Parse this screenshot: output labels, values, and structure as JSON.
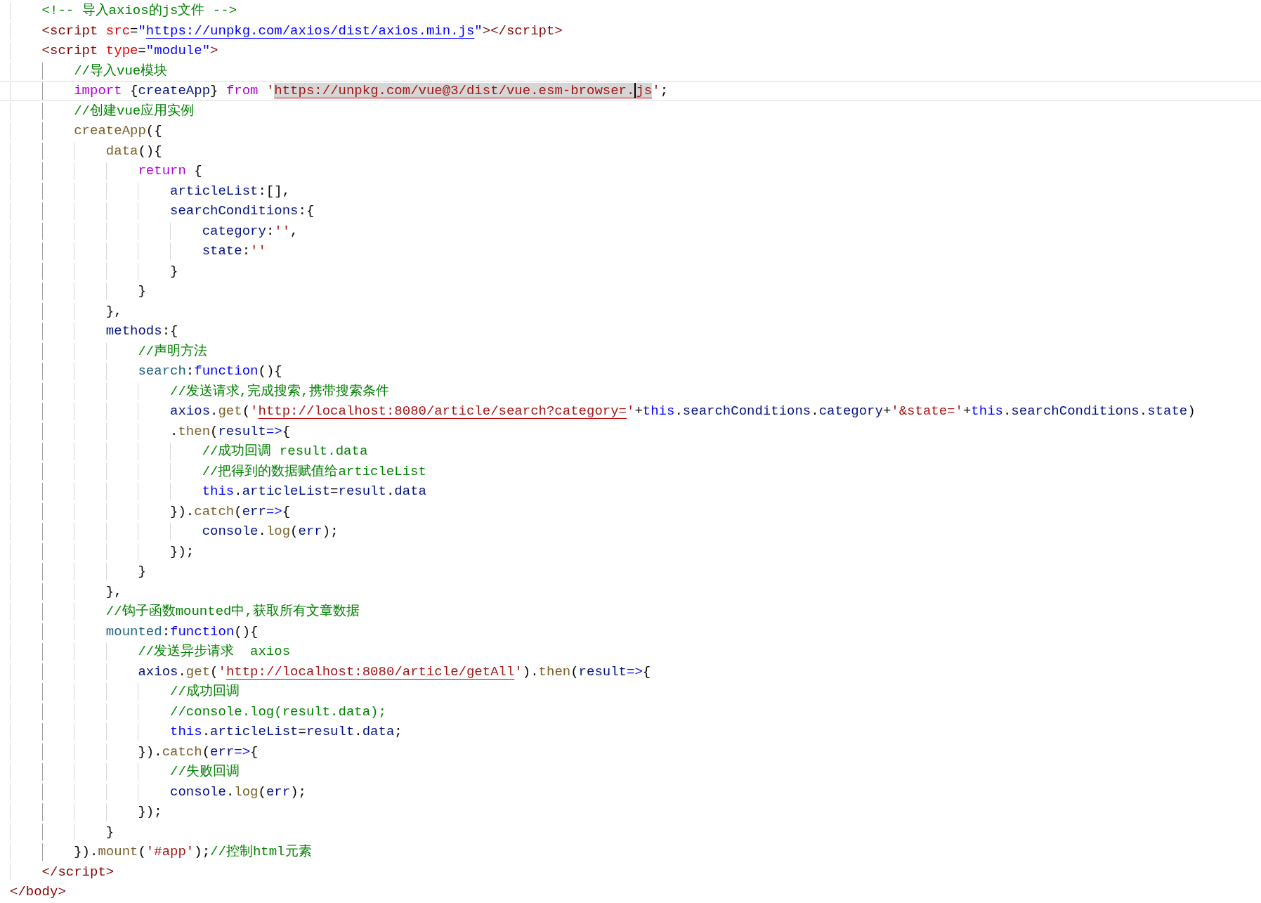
{
  "editor": {
    "lines": [
      {
        "selected": false,
        "tokens": [
          {
            "kind": "comment",
            "text": "    <!-- 导入axios的js文件 -->"
          }
        ]
      },
      {
        "selected": false,
        "tokens": [
          {
            "kind": "tag",
            "text": "    <script"
          },
          {
            "kind": "attr",
            "text": " src"
          },
          {
            "kind": "plain",
            "text": "="
          },
          {
            "kind": "attrval",
            "text": "\""
          },
          {
            "kind": "link",
            "text": "https://unpkg.com/axios/dist/axios.min.js"
          },
          {
            "kind": "attrval",
            "text": "\""
          },
          {
            "kind": "tag",
            "text": "></script>"
          }
        ]
      },
      {
        "selected": false,
        "tokens": [
          {
            "kind": "tag",
            "text": "    <script"
          },
          {
            "kind": "attr",
            "text": " type"
          },
          {
            "kind": "plain",
            "text": "="
          },
          {
            "kind": "attrval",
            "text": "\"module\""
          },
          {
            "kind": "tag",
            "text": ">"
          }
        ]
      },
      {
        "selected": false,
        "tokens": [
          {
            "kind": "comment",
            "text": "        //导入vue模块"
          }
        ]
      },
      {
        "selected": true,
        "tokens": [
          {
            "kind": "keyword",
            "text": "        import"
          },
          {
            "kind": "plain",
            "text": " {"
          },
          {
            "kind": "ident",
            "text": "createApp"
          },
          {
            "kind": "plain",
            "text": "} "
          },
          {
            "kind": "keyword",
            "text": "from"
          },
          {
            "kind": "string",
            "text": " '"
          },
          {
            "kind": "url-selection",
            "text": "https://unpkg.com/vue@3/dist/vue.esm-browser."
          },
          {
            "kind": "caret"
          },
          {
            "kind": "url-selection",
            "text": "js"
          },
          {
            "kind": "string",
            "text": "'"
          },
          {
            "kind": "plain",
            "text": ";"
          }
        ]
      },
      {
        "selected": false,
        "tokens": [
          {
            "kind": "comment",
            "text": "        //创建vue应用实例"
          }
        ]
      },
      {
        "selected": false,
        "tokens": [
          {
            "kind": "func",
            "text": "        createApp"
          },
          {
            "kind": "plain",
            "text": "({"
          }
        ]
      },
      {
        "selected": false,
        "tokens": [
          {
            "kind": "func",
            "text": "            data"
          },
          {
            "kind": "plain",
            "text": "(){"
          }
        ]
      },
      {
        "selected": false,
        "tokens": [
          {
            "kind": "keyword",
            "text": "                return"
          },
          {
            "kind": "plain",
            "text": " {"
          }
        ]
      },
      {
        "selected": false,
        "tokens": [
          {
            "kind": "ident",
            "text": "                    articleList"
          },
          {
            "kind": "plain",
            "text": ":[],"
          }
        ]
      },
      {
        "selected": false,
        "tokens": [
          {
            "kind": "ident",
            "text": "                    searchConditions"
          },
          {
            "kind": "plain",
            "text": ":{"
          }
        ]
      },
      {
        "selected": false,
        "tokens": [
          {
            "kind": "ident",
            "text": "                        category"
          },
          {
            "kind": "plain",
            "text": ":"
          },
          {
            "kind": "string",
            "text": "''"
          },
          {
            "kind": "plain",
            "text": ","
          }
        ]
      },
      {
        "selected": false,
        "tokens": [
          {
            "kind": "ident",
            "text": "                        state"
          },
          {
            "kind": "plain",
            "text": ":"
          },
          {
            "kind": "string",
            "text": "''"
          }
        ]
      },
      {
        "selected": false,
        "tokens": [
          {
            "kind": "plain",
            "text": "                    }"
          }
        ]
      },
      {
        "selected": false,
        "tokens": [
          {
            "kind": "plain",
            "text": "                }"
          }
        ]
      },
      {
        "selected": false,
        "tokens": [
          {
            "kind": "plain",
            "text": "            },"
          }
        ]
      },
      {
        "selected": false,
        "tokens": [
          {
            "kind": "ident",
            "text": "            methods"
          },
          {
            "kind": "plain",
            "text": ":{"
          }
        ]
      },
      {
        "selected": false,
        "tokens": [
          {
            "kind": "comment",
            "text": "                //声明方法"
          }
        ]
      },
      {
        "selected": false,
        "tokens": [
          {
            "kind": "property",
            "text": "                search"
          },
          {
            "kind": "plain",
            "text": ":"
          },
          {
            "kind": "storage",
            "text": "function"
          },
          {
            "kind": "plain",
            "text": "(){"
          }
        ]
      },
      {
        "selected": false,
        "tokens": [
          {
            "kind": "comment",
            "text": "                    //发送请求,完成搜索,携带搜索条件"
          }
        ]
      },
      {
        "selected": false,
        "tokens": [
          {
            "kind": "ident",
            "text": "                    axios"
          },
          {
            "kind": "plain",
            "text": "."
          },
          {
            "kind": "func",
            "text": "get"
          },
          {
            "kind": "plain",
            "text": "("
          },
          {
            "kind": "string",
            "text": "'"
          },
          {
            "kind": "url",
            "text": "http://localhost:8080/article/search?category="
          },
          {
            "kind": "string",
            "text": "'"
          },
          {
            "kind": "plain",
            "text": "+"
          },
          {
            "kind": "storage",
            "text": "this"
          },
          {
            "kind": "plain",
            "text": "."
          },
          {
            "kind": "ident",
            "text": "searchConditions"
          },
          {
            "kind": "plain",
            "text": "."
          },
          {
            "kind": "ident",
            "text": "category"
          },
          {
            "kind": "plain",
            "text": "+"
          },
          {
            "kind": "string",
            "text": "'&state='"
          },
          {
            "kind": "plain",
            "text": "+"
          },
          {
            "kind": "storage",
            "text": "this"
          },
          {
            "kind": "plain",
            "text": "."
          },
          {
            "kind": "ident",
            "text": "searchConditions"
          },
          {
            "kind": "plain",
            "text": "."
          },
          {
            "kind": "ident",
            "text": "state"
          },
          {
            "kind": "plain",
            "text": ")"
          }
        ]
      },
      {
        "selected": false,
        "tokens": [
          {
            "kind": "plain",
            "text": "                    ."
          },
          {
            "kind": "func",
            "text": "then"
          },
          {
            "kind": "plain",
            "text": "("
          },
          {
            "kind": "ident",
            "text": "result"
          },
          {
            "kind": "storage",
            "text": "=>"
          },
          {
            "kind": "plain",
            "text": "{"
          }
        ]
      },
      {
        "selected": false,
        "tokens": [
          {
            "kind": "comment",
            "text": "                        //成功回调 result.data"
          }
        ]
      },
      {
        "selected": false,
        "tokens": [
          {
            "kind": "comment",
            "text": "                        //把得到的数据赋值给articleList"
          }
        ]
      },
      {
        "selected": false,
        "tokens": [
          {
            "kind": "storage",
            "text": "                        this"
          },
          {
            "kind": "plain",
            "text": "."
          },
          {
            "kind": "ident",
            "text": "articleList"
          },
          {
            "kind": "plain",
            "text": "="
          },
          {
            "kind": "ident",
            "text": "result"
          },
          {
            "kind": "plain",
            "text": "."
          },
          {
            "kind": "ident",
            "text": "data"
          }
        ]
      },
      {
        "selected": false,
        "tokens": [
          {
            "kind": "plain",
            "text": "                    })."
          },
          {
            "kind": "func",
            "text": "catch"
          },
          {
            "kind": "plain",
            "text": "("
          },
          {
            "kind": "ident",
            "text": "err"
          },
          {
            "kind": "storage",
            "text": "=>"
          },
          {
            "kind": "plain",
            "text": "{"
          }
        ]
      },
      {
        "selected": false,
        "tokens": [
          {
            "kind": "ident",
            "text": "                        console"
          },
          {
            "kind": "plain",
            "text": "."
          },
          {
            "kind": "func",
            "text": "log"
          },
          {
            "kind": "plain",
            "text": "("
          },
          {
            "kind": "ident",
            "text": "err"
          },
          {
            "kind": "plain",
            "text": ");"
          }
        ]
      },
      {
        "selected": false,
        "tokens": [
          {
            "kind": "plain",
            "text": "                    });"
          }
        ]
      },
      {
        "selected": false,
        "tokens": [
          {
            "kind": "plain",
            "text": "                }"
          }
        ]
      },
      {
        "selected": false,
        "tokens": [
          {
            "kind": "plain",
            "text": "            },"
          }
        ]
      },
      {
        "selected": false,
        "tokens": [
          {
            "kind": "comment",
            "text": "            //钩子函数mounted中,获取所有文章数据"
          }
        ]
      },
      {
        "selected": false,
        "tokens": [
          {
            "kind": "property",
            "text": "            mounted"
          },
          {
            "kind": "plain",
            "text": ":"
          },
          {
            "kind": "storage",
            "text": "function"
          },
          {
            "kind": "plain",
            "text": "(){"
          }
        ]
      },
      {
        "selected": false,
        "tokens": [
          {
            "kind": "comment",
            "text": "                //发送异步请求  axios"
          }
        ]
      },
      {
        "selected": false,
        "tokens": [
          {
            "kind": "ident",
            "text": "                axios"
          },
          {
            "kind": "plain",
            "text": "."
          },
          {
            "kind": "func",
            "text": "get"
          },
          {
            "kind": "plain",
            "text": "("
          },
          {
            "kind": "string",
            "text": "'"
          },
          {
            "kind": "url",
            "text": "http://localhost:8080/article/getAll"
          },
          {
            "kind": "string",
            "text": "'"
          },
          {
            "kind": "plain",
            "text": ")."
          },
          {
            "kind": "func",
            "text": "then"
          },
          {
            "kind": "plain",
            "text": "("
          },
          {
            "kind": "ident",
            "text": "result"
          },
          {
            "kind": "storage",
            "text": "=>"
          },
          {
            "kind": "plain",
            "text": "{"
          }
        ]
      },
      {
        "selected": false,
        "tokens": [
          {
            "kind": "comment",
            "text": "                    //成功回调"
          }
        ]
      },
      {
        "selected": false,
        "tokens": [
          {
            "kind": "comment",
            "text": "                    //console.log(result.data);"
          }
        ]
      },
      {
        "selected": false,
        "tokens": [
          {
            "kind": "storage",
            "text": "                    this"
          },
          {
            "kind": "plain",
            "text": "."
          },
          {
            "kind": "ident",
            "text": "articleList"
          },
          {
            "kind": "plain",
            "text": "="
          },
          {
            "kind": "ident",
            "text": "result"
          },
          {
            "kind": "plain",
            "text": "."
          },
          {
            "kind": "ident",
            "text": "data"
          },
          {
            "kind": "plain",
            "text": ";"
          }
        ]
      },
      {
        "selected": false,
        "tokens": [
          {
            "kind": "plain",
            "text": "                })."
          },
          {
            "kind": "func",
            "text": "catch"
          },
          {
            "kind": "plain",
            "text": "("
          },
          {
            "kind": "ident",
            "text": "err"
          },
          {
            "kind": "storage",
            "text": "=>"
          },
          {
            "kind": "plain",
            "text": "{"
          }
        ]
      },
      {
        "selected": false,
        "tokens": [
          {
            "kind": "comment",
            "text": "                    //失败回调"
          }
        ]
      },
      {
        "selected": false,
        "tokens": [
          {
            "kind": "ident",
            "text": "                    console"
          },
          {
            "kind": "plain",
            "text": "."
          },
          {
            "kind": "func",
            "text": "log"
          },
          {
            "kind": "plain",
            "text": "("
          },
          {
            "kind": "ident",
            "text": "err"
          },
          {
            "kind": "plain",
            "text": ");"
          }
        ]
      },
      {
        "selected": false,
        "tokens": [
          {
            "kind": "plain",
            "text": "                });"
          }
        ]
      },
      {
        "selected": false,
        "tokens": [
          {
            "kind": "plain",
            "text": "            }"
          }
        ]
      },
      {
        "selected": false,
        "tokens": [
          {
            "kind": "plain",
            "text": "        })."
          },
          {
            "kind": "func",
            "text": "mount"
          },
          {
            "kind": "plain",
            "text": "("
          },
          {
            "kind": "string",
            "text": "'#app'"
          },
          {
            "kind": "plain",
            "text": ");"
          },
          {
            "kind": "comment",
            "text": "//控制html元素"
          }
        ]
      },
      {
        "selected": false,
        "tokens": [
          {
            "kind": "tag",
            "text": "    </script>"
          }
        ]
      },
      {
        "selected": false,
        "tokens": [
          {
            "kind": "tag",
            "text": "</body>"
          }
        ]
      }
    ]
  }
}
